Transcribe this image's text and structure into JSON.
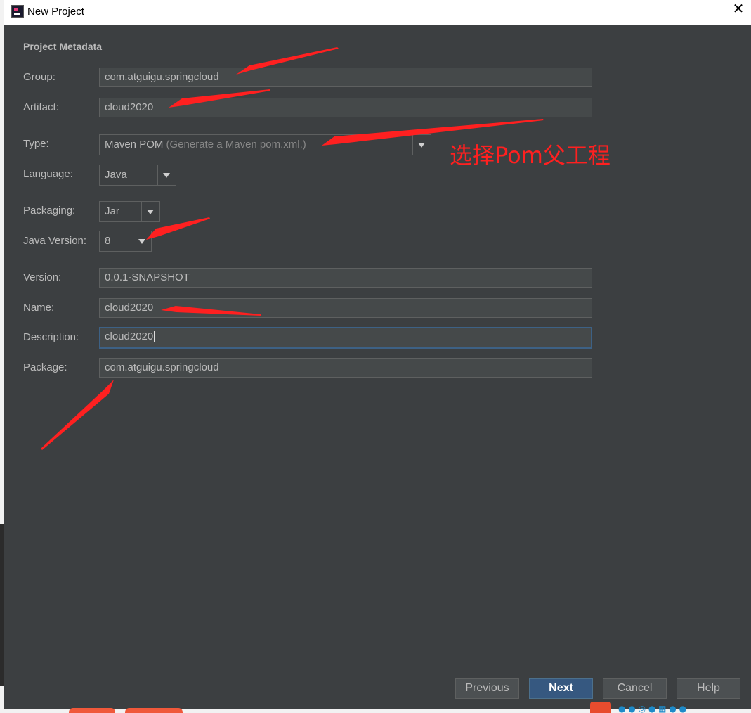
{
  "window": {
    "title": "New Project"
  },
  "section": {
    "title": "Project Metadata"
  },
  "fields": {
    "group": {
      "label": "Group:",
      "value": "com.atguigu.springcloud"
    },
    "artifact": {
      "label": "Artifact:",
      "value": "cloud2020"
    },
    "type": {
      "label": "Type:",
      "value": "Maven POM",
      "hint": "(Generate a Maven pom.xml.)"
    },
    "language": {
      "label": "Language:",
      "value": "Java"
    },
    "packaging": {
      "label": "Packaging:",
      "value": "Jar"
    },
    "java_version": {
      "label": "Java Version:",
      "value": "8"
    },
    "version": {
      "label": "Version:",
      "value": "0.0.1-SNAPSHOT"
    },
    "name": {
      "label": "Name:",
      "value": "cloud2020"
    },
    "description": {
      "label": "Description:",
      "value": "cloud2020"
    },
    "package": {
      "label": "Package:",
      "value": "com.atguigu.springcloud"
    }
  },
  "annotation": {
    "text": "选择Pom父工程",
    "color": "#ff2020"
  },
  "buttons": {
    "previous": "Previous",
    "next": "Next",
    "cancel": "Cancel",
    "help": "Help"
  },
  "colors": {
    "dialog_bg": "#3c3f41",
    "field_bg": "#45494a",
    "primary_button": "#365880",
    "focus_border": "#3d6185"
  },
  "icons": {
    "app": "intellij-icon",
    "close": "close-icon",
    "dropdown": "chevron-down-icon"
  }
}
